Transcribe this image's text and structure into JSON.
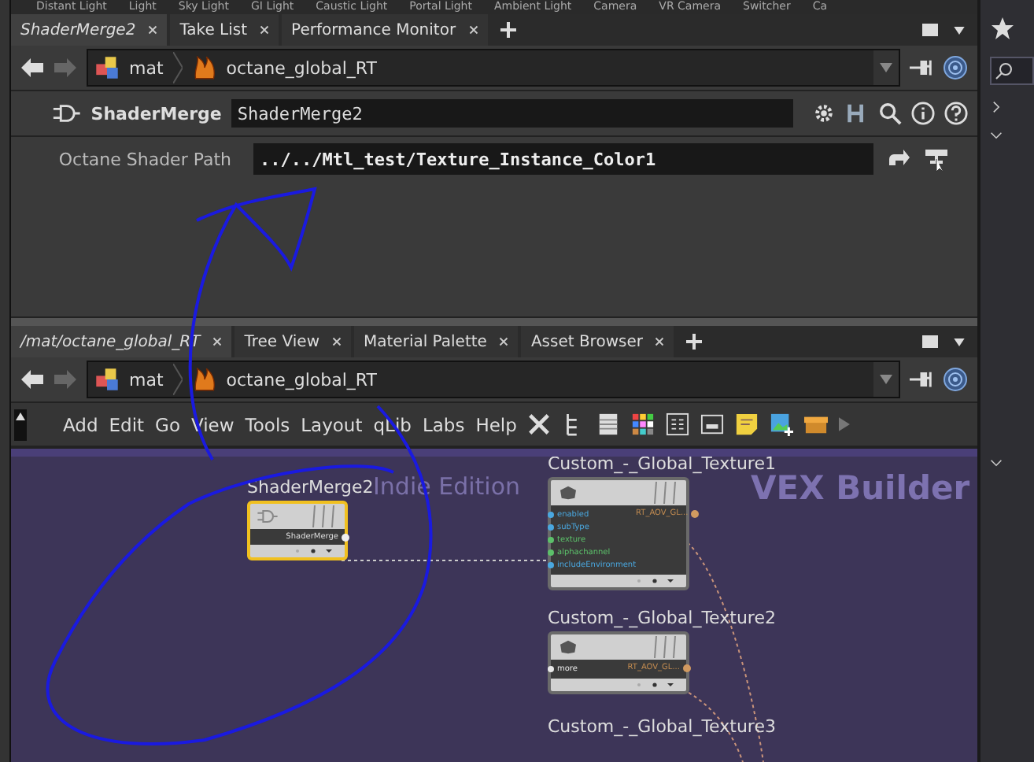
{
  "shelf": [
    "Distant Light",
    "Light",
    "Sky Light",
    "GI Light",
    "Caustic Light",
    "Portal Light",
    "Ambient Light",
    "Camera",
    "VR Camera",
    "Switcher",
    "Ca"
  ],
  "top_pane": {
    "tabs": [
      {
        "label": "ShaderMerge2",
        "selected": true
      },
      {
        "label": "Take List",
        "selected": false
      },
      {
        "label": "Performance Monitor",
        "selected": false
      }
    ],
    "path": [
      "mat",
      "octane_global_RT"
    ],
    "node_type": "ShaderMerge",
    "node_name": "ShaderMerge2",
    "parameters": [
      {
        "label": "Octane Shader Path",
        "value": "../../Mtl_test/Texture_Instance_Color1"
      }
    ]
  },
  "bottom_pane": {
    "tabs": [
      {
        "label": "/mat/octane_global_RT",
        "selected": true
      },
      {
        "label": "Tree View",
        "selected": false
      },
      {
        "label": "Material Palette",
        "selected": false
      },
      {
        "label": "Asset Browser",
        "selected": false
      }
    ],
    "path": [
      "mat",
      "octane_global_RT"
    ],
    "menu": [
      "Add",
      "Edit",
      "Go",
      "View",
      "Tools",
      "Layout",
      "qLib",
      "Labs",
      "Help"
    ],
    "network": {
      "watermark": "Indie Edition",
      "context": "VEX Builder",
      "nodes": [
        {
          "name": "ShaderMerge2",
          "selected": true,
          "output": "ShaderMerge",
          "kind": "merge"
        },
        {
          "name": "Custom_-_Global_Texture1",
          "selected": false,
          "kind": "texture",
          "output": "RT_AOV_GL...",
          "inputs": [
            {
              "name": "enabled",
              "color": "#4aa8e0"
            },
            {
              "name": "subType",
              "color": "#4aa8e0"
            },
            {
              "name": "texture",
              "color": "#5cc06a"
            },
            {
              "name": "alphachannel",
              "color": "#5cc06a"
            },
            {
              "name": "includeEnvironment",
              "color": "#4aa8e0"
            }
          ]
        },
        {
          "name": "Custom_-_Global_Texture2",
          "selected": false,
          "kind": "texture",
          "output": "RT_AOV_GL...",
          "inputs": [
            {
              "name": "more",
              "color": "#e8e8e8"
            }
          ]
        },
        {
          "name": "Custom_-_Global_Texture3",
          "kind": "label"
        }
      ]
    }
  }
}
